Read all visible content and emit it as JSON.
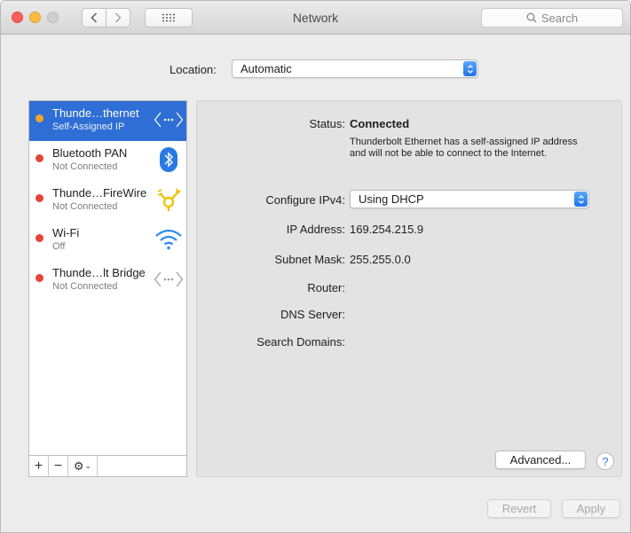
{
  "window": {
    "title": "Network"
  },
  "toolbar": {
    "search_placeholder": "Search",
    "back_icon": "chevron-left-icon",
    "forward_icon": "chevron-right-icon",
    "grid_icon": "grid-icon"
  },
  "location": {
    "label": "Location:",
    "value": "Automatic"
  },
  "services": [
    {
      "name": "Thunde…thernet",
      "status": "Self-Assigned IP",
      "status_color": "#f5a623",
      "icon": "ethernet-icon",
      "selected": true
    },
    {
      "name": "Bluetooth PAN",
      "status": "Not Connected",
      "status_color": "#e3443b",
      "icon": "bluetooth-icon"
    },
    {
      "name": "Thunde…FireWire",
      "status": "Not Connected",
      "status_color": "#e3443b",
      "icon": "firewire-icon"
    },
    {
      "name": "Wi-Fi",
      "status": "Off",
      "status_color": "#e3443b",
      "icon": "wifi-icon"
    },
    {
      "name": "Thunde…lt Bridge",
      "status": "Not Connected",
      "status_color": "#e3443b",
      "icon": "bridge-icon"
    }
  ],
  "sidebar_tools": {
    "add": "+",
    "remove": "−",
    "action_icon": "gear-icon"
  },
  "detail": {
    "status_label": "Status:",
    "status_value": "Connected",
    "status_description": "Thunderbolt Ethernet has a self-assigned IP address and will not be able to connect to the Internet.",
    "configure_label": "Configure IPv4:",
    "configure_value": "Using DHCP",
    "ip_label": "IP Address:",
    "ip_value": "169.254.215.9",
    "subnet_label": "Subnet Mask:",
    "subnet_value": "255.255.0.0",
    "router_label": "Router:",
    "router_value": "",
    "dns_label": "DNS Server:",
    "dns_value": "",
    "search_domains_label": "Search Domains:",
    "search_domains_value": "",
    "advanced_label": "Advanced...",
    "help_label": "?"
  },
  "footer": {
    "revert_label": "Revert",
    "apply_label": "Apply"
  },
  "colors": {
    "accent": "#2e6ed5",
    "popup_arrow": "#1f73ea"
  }
}
